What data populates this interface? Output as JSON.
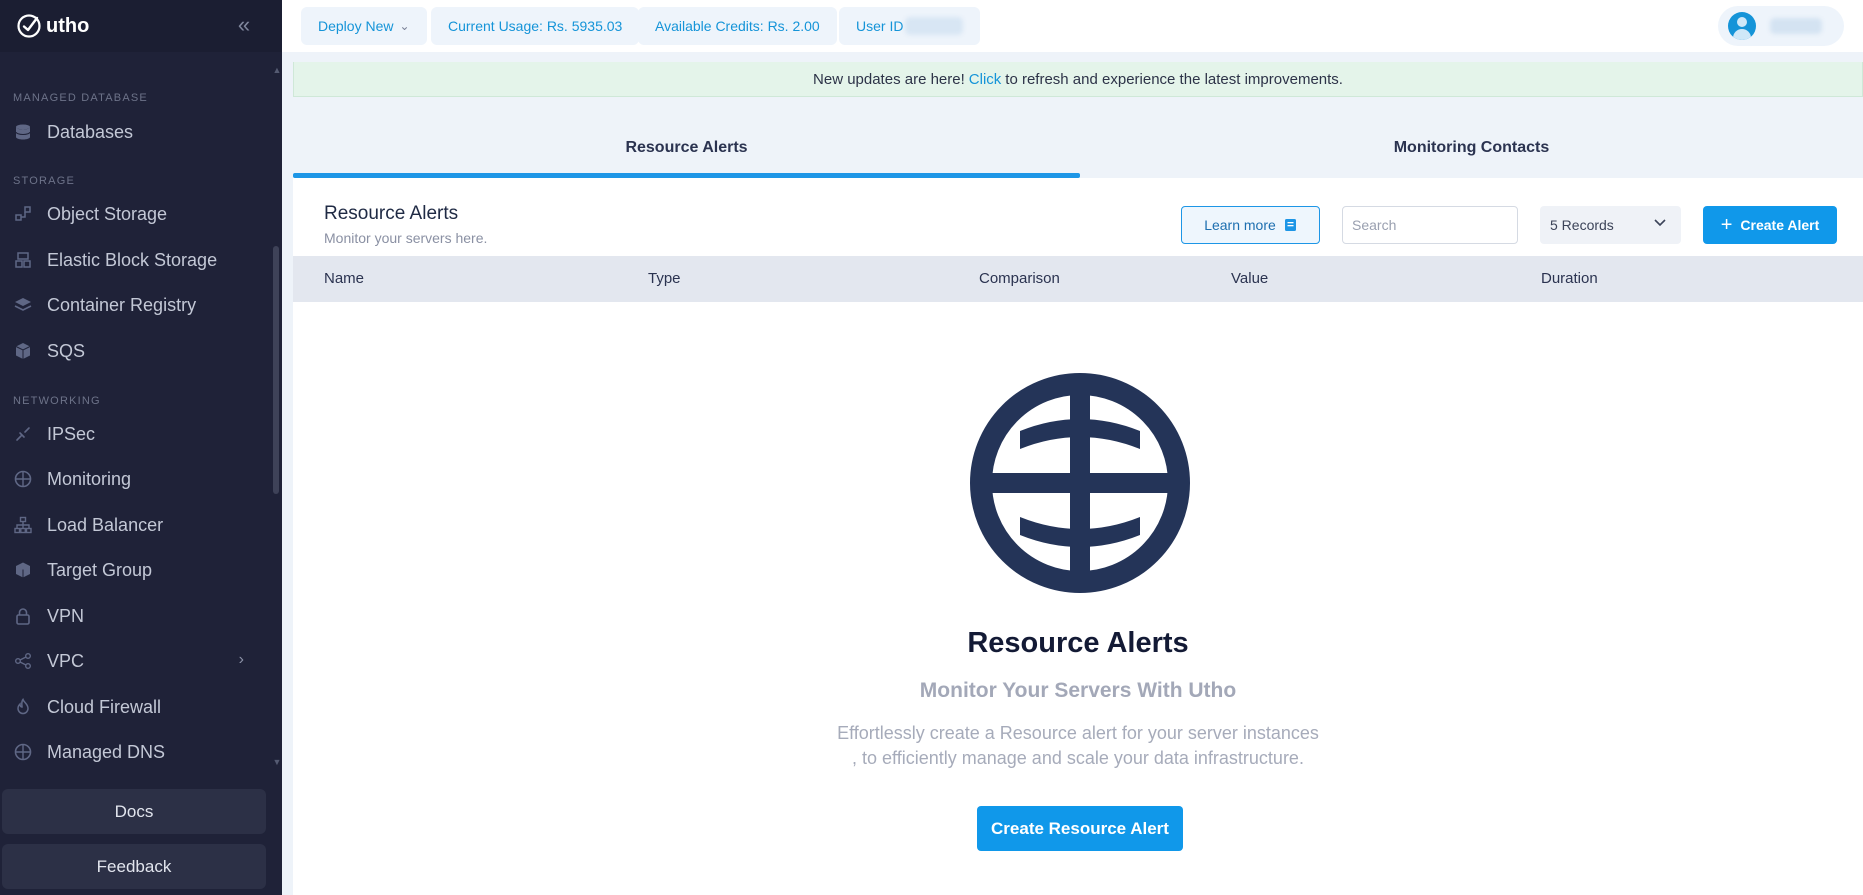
{
  "sidebar": {
    "brand": "utho",
    "sections": [
      {
        "label": "MANAGED DATABASE",
        "items": [
          {
            "label": "Databases",
            "icon": "database-icon"
          }
        ]
      },
      {
        "label": "STORAGE",
        "items": [
          {
            "label": "Object Storage",
            "icon": "object-storage-icon"
          },
          {
            "label": "Elastic Block Storage",
            "icon": "block-storage-icon"
          },
          {
            "label": "Container Registry",
            "icon": "layers-icon"
          },
          {
            "label": "SQS",
            "icon": "cube-stack-icon"
          }
        ]
      },
      {
        "label": "NETWORKING",
        "items": [
          {
            "label": "IPSec",
            "icon": "link-icon"
          },
          {
            "label": "Monitoring",
            "icon": "globe-icon"
          },
          {
            "label": "Load Balancer",
            "icon": "sitemap-icon"
          },
          {
            "label": "Target Group",
            "icon": "box-icon"
          },
          {
            "label": "VPN",
            "icon": "lock-icon"
          },
          {
            "label": "VPC",
            "icon": "share-icon",
            "has_submenu": true
          },
          {
            "label": "Cloud Firewall",
            "icon": "fire-icon"
          },
          {
            "label": "Managed DNS",
            "icon": "globe-icon"
          }
        ]
      }
    ],
    "docs_label": "Docs",
    "feedback_label": "Feedback"
  },
  "topbar": {
    "deploy_label": "Deploy New",
    "usage_label": "Current Usage: Rs. 5935.03",
    "credits_label": "Available Credits: Rs. 2.00",
    "user_id_label": "User ID"
  },
  "banner": {
    "before": "New updates are here!",
    "link": "Click",
    "after": "to refresh and experience the latest improvements."
  },
  "tabs": [
    {
      "label": "Resource Alerts",
      "active": true
    },
    {
      "label": "Monitoring Contacts",
      "active": false
    }
  ],
  "card": {
    "title": "Resource Alerts",
    "subtitle": "Monitor your servers here.",
    "learn_more_label": "Learn more",
    "search_placeholder": "Search",
    "records_label": "5 Records",
    "create_label": "Create Alert",
    "columns": [
      "Name",
      "Type",
      "Comparison",
      "Value",
      "Duration"
    ]
  },
  "empty_state": {
    "title": "Resource Alerts",
    "subtitle": "Monitor Your Servers With Utho",
    "description_line1": "Effortlessly create a Resource alert for your server instances",
    "description_line2": ", to efficiently manage and scale your data infrastructure.",
    "button_label": "Create Resource Alert"
  },
  "colors": {
    "sidebar_bg": "#1f2238",
    "accent": "#1098ea",
    "globe": "#243458",
    "banner_bg": "#e4f4ea"
  }
}
